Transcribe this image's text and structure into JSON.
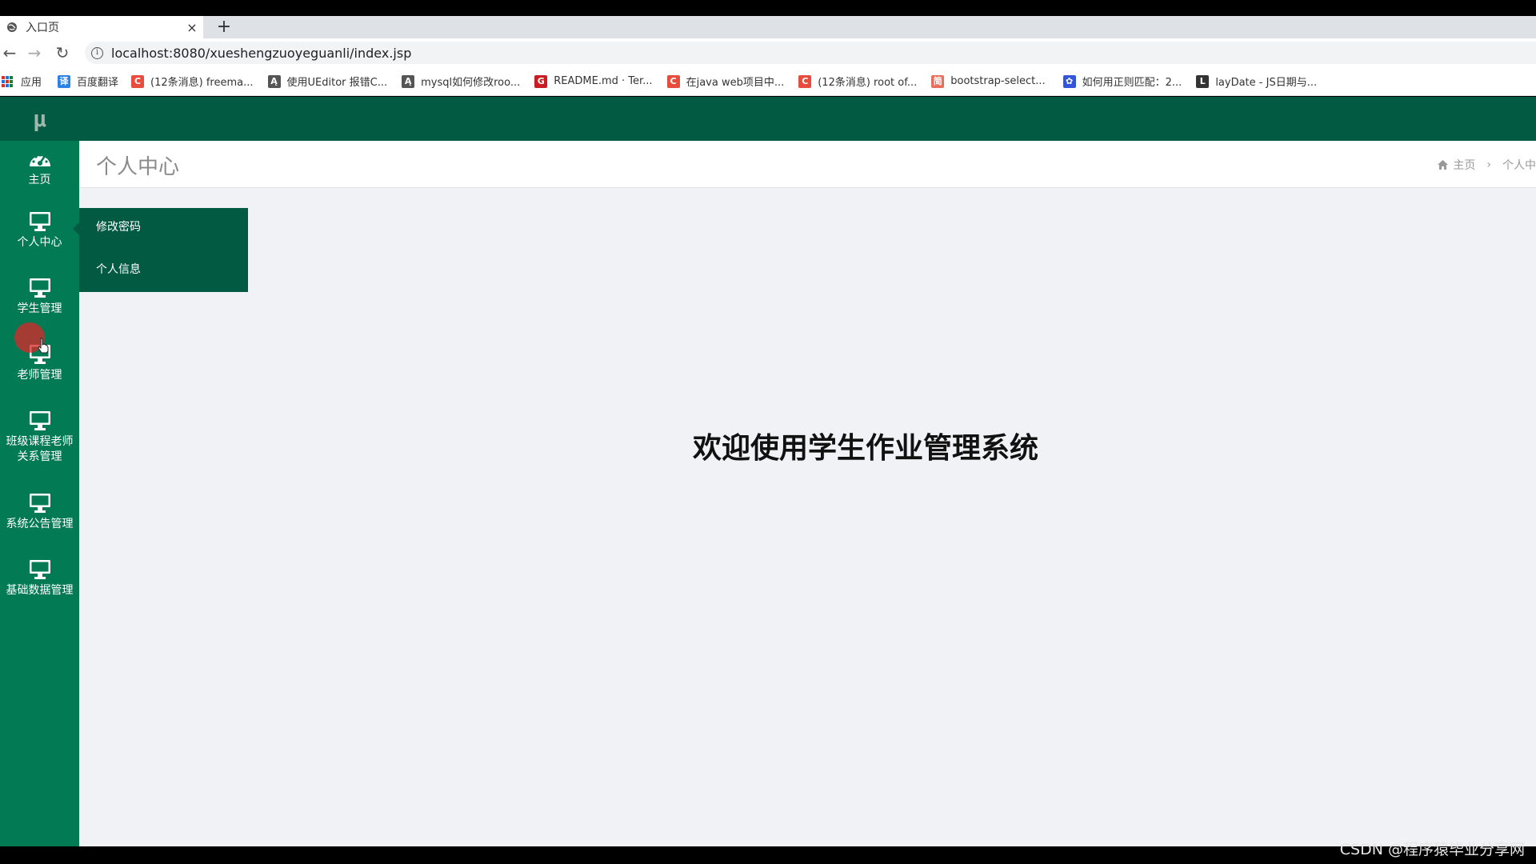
{
  "browser": {
    "tab_title": "入口页",
    "tab_close": "×",
    "new_tab": "+",
    "url": "localhost:8080/xueshengzuoyeguanli/index.jsp",
    "back": "←",
    "forward": "→",
    "reload": "↻"
  },
  "bookmarks": [
    {
      "label": "应用",
      "icon": "apps-icon"
    },
    {
      "label": "百度翻译",
      "icon": "baidu-translate-icon",
      "color": "#2b82e6",
      "glyph": "译"
    },
    {
      "label": "(12条消息) freema...",
      "icon": "csdn-icon",
      "color": "#e74c3c",
      "glyph": "C"
    },
    {
      "label": "使用UEditor 报错C...",
      "icon": "ueditor-icon",
      "color": "#555555",
      "glyph": "Ą"
    },
    {
      "label": "mysql如何修改roo...",
      "icon": "ueditor-icon",
      "color": "#555555",
      "glyph": "Ą"
    },
    {
      "label": "README.md · Ter...",
      "icon": "gitee-icon",
      "color": "#c71d23",
      "glyph": "G"
    },
    {
      "label": "在java web项目中...",
      "icon": "csdn-icon",
      "color": "#e74c3c",
      "glyph": "C"
    },
    {
      "label": "(12条消息) root of...",
      "icon": "csdn-icon",
      "color": "#e74c3c",
      "glyph": "C"
    },
    {
      "label": "bootstrap-select...",
      "icon": "jianshu-icon",
      "color": "#ea6f5a",
      "glyph": "简"
    },
    {
      "label": "如何用正则匹配：2...",
      "icon": "baidu-paw-icon",
      "color": "#3355dd",
      "glyph": "✿"
    },
    {
      "label": "layDate - JS日期与...",
      "icon": "laydate-icon",
      "color": "#333333",
      "glyph": "L"
    }
  ],
  "app": {
    "logo": "μ",
    "page_title": "个人中心",
    "breadcrumb": {
      "home": "主页",
      "current": "个人中",
      "sep": "›"
    },
    "welcome": "欢迎使用学生作业管理系统",
    "sidebar": [
      {
        "label": "主页",
        "icon": "dashboard-icon"
      },
      {
        "label": "个人中心",
        "icon": "monitor-icon"
      },
      {
        "label": "学生管理",
        "icon": "monitor-icon"
      },
      {
        "label": "老师管理",
        "icon": "monitor-icon"
      },
      {
        "label": "班级课程老师关系管理",
        "line1": "班级课程老师",
        "line2": "关系管理",
        "icon": "monitor-icon"
      },
      {
        "label": "系统公告管理",
        "icon": "monitor-icon"
      },
      {
        "label": "基础数据管理",
        "icon": "monitor-icon"
      }
    ],
    "submenu": [
      {
        "label": "修改密码"
      },
      {
        "label": "个人信息"
      }
    ],
    "colors": {
      "topnav": "#025a43",
      "sidebar": "#027a53",
      "content_bg": "#f1f2f5"
    }
  },
  "watermark": "CSDN @程序猿毕业分享网"
}
